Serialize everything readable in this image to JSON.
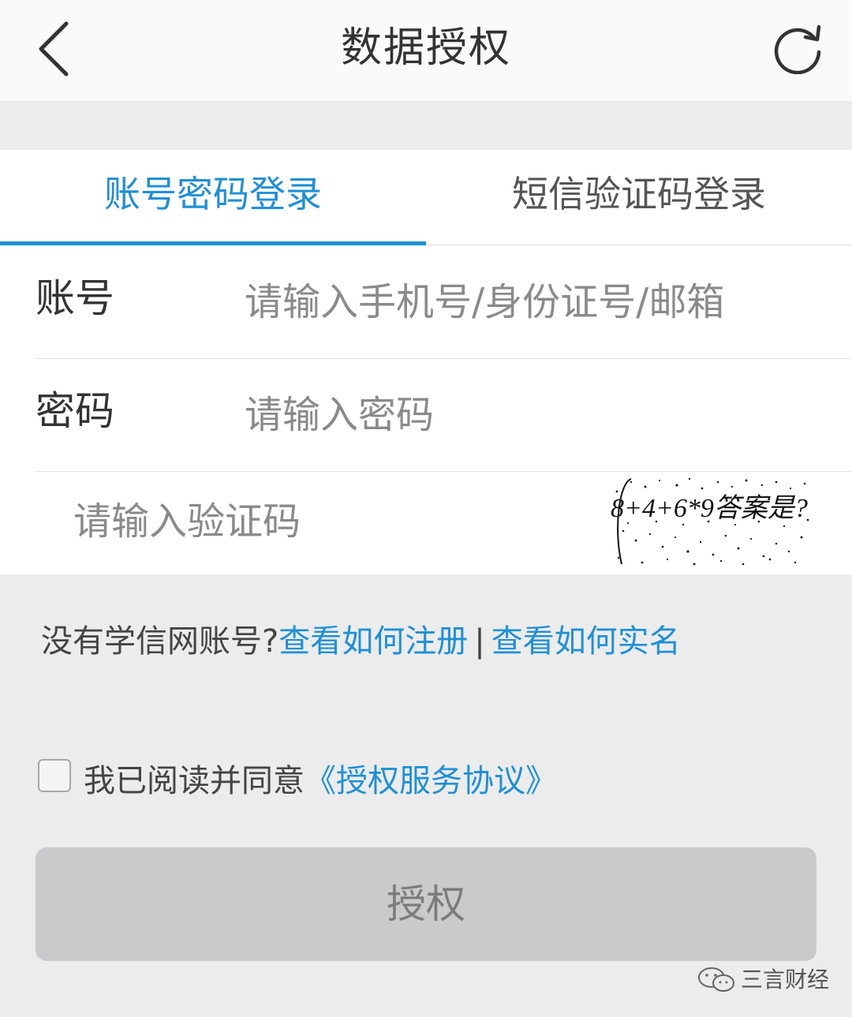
{
  "header": {
    "title": "数据授权",
    "back_icon": "chevron-left-icon",
    "refresh_icon": "refresh-icon"
  },
  "tabs": [
    {
      "label": "账号密码登录",
      "active": true
    },
    {
      "label": "短信验证码登录",
      "active": false
    }
  ],
  "form": {
    "account": {
      "label": "账号",
      "placeholder": "请输入手机号/身份证号/邮箱",
      "value": ""
    },
    "password": {
      "label": "密码",
      "placeholder": "请输入密码",
      "value": ""
    },
    "captcha": {
      "placeholder": "请输入验证码",
      "value": "",
      "image_text": "8+4+6*9答案是?"
    }
  },
  "help": {
    "prompt": "没有学信网账号?",
    "register_link": "查看如何注册",
    "separator": "|",
    "realname_link": "查看如何实名"
  },
  "agreement": {
    "prefix": "我已阅读并同意",
    "link": "《授权服务协议》",
    "checked": false
  },
  "submit": {
    "label": "授权",
    "enabled": false
  },
  "watermark": {
    "text": "三言财经",
    "icon": "wechat-icon"
  },
  "colors": {
    "accent": "#1f8fd6",
    "background": "#ececec",
    "button_disabled": "#c9cacc"
  }
}
